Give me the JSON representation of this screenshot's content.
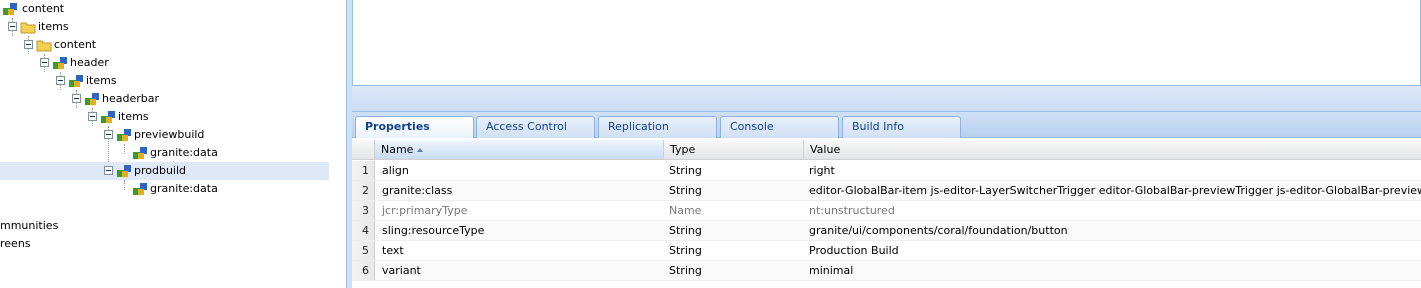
{
  "tree": {
    "nodes": [
      {
        "label": "content",
        "icon": "node-icon",
        "expanded": true
      },
      {
        "label": "items",
        "icon": "folder-icon",
        "expanded": true
      },
      {
        "label": "content",
        "icon": "folder-icon",
        "expanded": true
      },
      {
        "label": "header",
        "icon": "node-icon",
        "expanded": true
      },
      {
        "label": "items",
        "icon": "node-icon",
        "expanded": true
      },
      {
        "label": "headerbar",
        "icon": "node-icon",
        "expanded": true
      },
      {
        "label": "items",
        "icon": "node-icon",
        "expanded": true
      },
      {
        "label": "previewbuild",
        "icon": "node-icon",
        "expanded": true
      },
      {
        "label": "granite:data",
        "icon": "node-icon",
        "expanded": false
      },
      {
        "label": "prodbuild",
        "icon": "node-icon",
        "expanded": true,
        "selected": true
      },
      {
        "label": "granite:data",
        "icon": "node-icon",
        "expanded": false
      },
      {
        "label": "mmunities",
        "icon": "",
        "expanded": false
      },
      {
        "label": "reens",
        "icon": "",
        "expanded": false
      }
    ]
  },
  "tabs": [
    {
      "label": "Properties",
      "active": true
    },
    {
      "label": "Access Control",
      "active": false
    },
    {
      "label": "Replication",
      "active": false
    },
    {
      "label": "Console",
      "active": false
    },
    {
      "label": "Build Info",
      "active": false
    }
  ],
  "grid": {
    "columns": [
      "Name",
      "Type",
      "Value"
    ],
    "sorted_column": "Name",
    "rows": [
      {
        "num": "1",
        "name": "align",
        "type": "String",
        "value": "right"
      },
      {
        "num": "2",
        "name": "granite:class",
        "type": "String",
        "value": "editor-GlobalBar-item js-editor-LayerSwitcherTrigger editor-GlobalBar-previewTrigger js-editor-GlobalBar-previewTrigger"
      },
      {
        "num": "3",
        "name": "jcr:primaryType",
        "type": "Name",
        "value": "nt:unstructured"
      },
      {
        "num": "4",
        "name": "sling:resourceType",
        "type": "String",
        "value": "granite/ui/components/coral/foundation/button"
      },
      {
        "num": "5",
        "name": "text",
        "type": "String",
        "value": "Production Build"
      },
      {
        "num": "6",
        "name": "variant",
        "type": "String",
        "value": "minimal"
      }
    ]
  },
  "colors": {
    "selection": "#dfe8f6",
    "accent": "#15428b",
    "border": "#99bbe8"
  }
}
